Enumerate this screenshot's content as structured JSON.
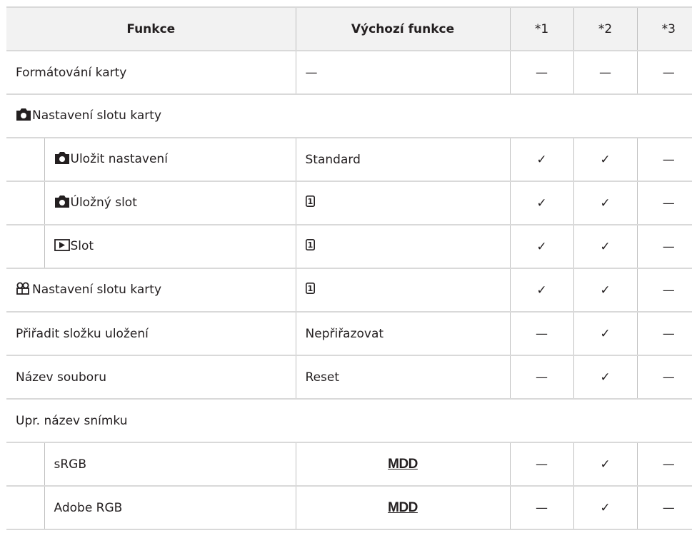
{
  "header": {
    "col_function": "Funkce",
    "col_default": "Výchozí funkce",
    "col1": "*1",
    "col2": "*2",
    "col3": "*3"
  },
  "rows": {
    "format": {
      "label": "Formátování karty",
      "default": "—",
      "c1": "—",
      "c2": "—",
      "c3": "—"
    },
    "card_slot_photo": {
      "label": "Nastavení slotu karty"
    },
    "save_settings": {
      "label": "Uložit nastavení",
      "default": "Standard",
      "c1": "✓",
      "c2": "✓",
      "c3": "—"
    },
    "save_slot": {
      "label": "Úložný slot",
      "default": "1",
      "c1": "✓",
      "c2": "✓",
      "c3": "—"
    },
    "play_slot": {
      "label": "Slot",
      "default": "1",
      "c1": "✓",
      "c2": "✓",
      "c3": "—"
    },
    "card_slot_movie": {
      "label": "Nastavení slotu karty",
      "default": "1",
      "c1": "✓",
      "c2": "✓",
      "c3": "—"
    },
    "assign_folder": {
      "label": "Přiřadit složku uložení",
      "default": "Nepřiřazovat",
      "c1": "—",
      "c2": "✓",
      "c3": "—"
    },
    "file_name": {
      "label": "Název souboru",
      "default": "Reset",
      "c1": "—",
      "c2": "✓",
      "c3": "—"
    },
    "edit_name": {
      "label": "Upr. název snímku"
    },
    "srgb": {
      "label": "sRGB",
      "default": "MDD",
      "c1": "—",
      "c2": "✓",
      "c3": "—"
    },
    "adobe_rgb": {
      "label": "Adobe RGB",
      "default": "MDD",
      "c1": "—",
      "c2": "✓",
      "c3": "—"
    }
  }
}
